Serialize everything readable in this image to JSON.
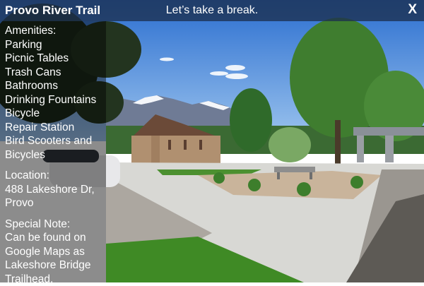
{
  "header": {
    "title": "Provo River Trail",
    "message": "Let’s take a break.",
    "close_label": "X"
  },
  "panel": {
    "amenities_heading": "Amenities:",
    "amenities": [
      "Parking",
      "Picnic Tables",
      "Trash Cans",
      "Bathrooms",
      "Drinking Fountains",
      "Bicycle",
      "Repair Station",
      "Bird Scooters and",
      "Bicycles"
    ],
    "location_heading": "Location:",
    "location_lines": [
      "488 Lakeshore Dr,",
      "Provo"
    ],
    "note_heading": "Special Note:",
    "note_lines": [
      "Can be found on",
      "Google Maps as",
      "Lakeshore Bridge",
      "Trailhead."
    ]
  },
  "colors": {
    "header_bg": "#1c304e",
    "sky": "#3f7fd6",
    "grass": "#3f8a25"
  }
}
